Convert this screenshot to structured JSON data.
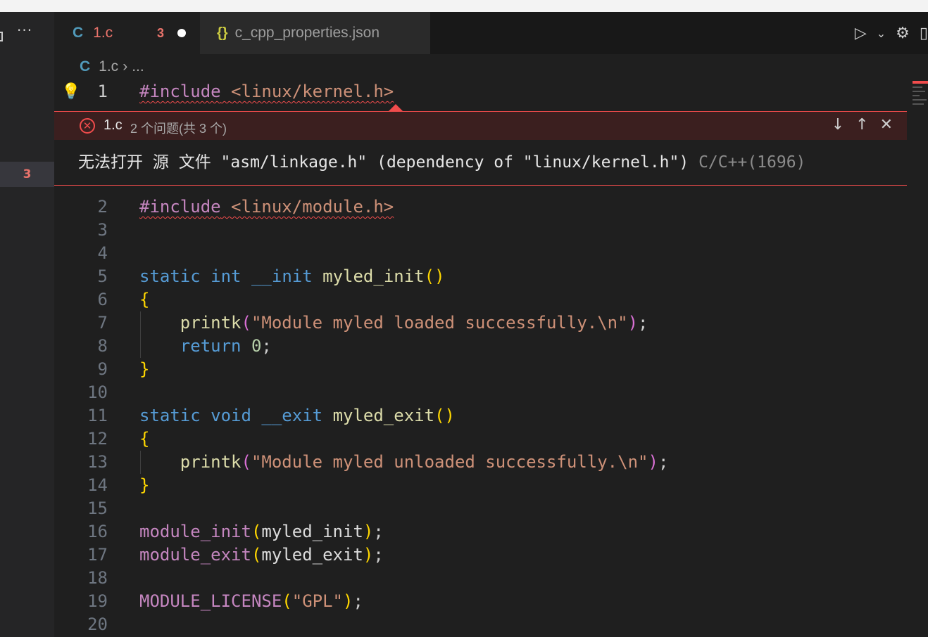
{
  "tabs": [
    {
      "icon": "C",
      "label": "1.c",
      "problems": "3",
      "modified": true,
      "active": true
    },
    {
      "icon": "{}",
      "label": "c_cpp_properties.json",
      "active": false
    }
  ],
  "sidebar": {
    "more": "···",
    "problems_badge": "3"
  },
  "breadcrumb": {
    "icon": "C",
    "file": "1.c",
    "sep": "›",
    "rest": "..."
  },
  "peek": {
    "file": "1.c",
    "count": "2 个问题(共 3 个)",
    "message": "无法打开 源 文件 \"asm/linkage.h\" (dependency of \"linux/kernel.h\")",
    "code": "C/C++(1696)",
    "next": "↓",
    "prev": "↑",
    "close": "✕"
  },
  "lines": [
    {
      "n": "1"
    },
    {
      "n": "2"
    },
    {
      "n": "3"
    },
    {
      "n": "4"
    },
    {
      "n": "5"
    },
    {
      "n": "6"
    },
    {
      "n": "7"
    },
    {
      "n": "8"
    },
    {
      "n": "9"
    },
    {
      "n": "10"
    },
    {
      "n": "11"
    },
    {
      "n": "12"
    },
    {
      "n": "13"
    },
    {
      "n": "14"
    },
    {
      "n": "15"
    },
    {
      "n": "16"
    },
    {
      "n": "17"
    },
    {
      "n": "18"
    },
    {
      "n": "19"
    },
    {
      "n": "20"
    }
  ],
  "code": {
    "l1_pp": "#include",
    "l1_inc": "<linux/kernel.h>",
    "l2_pp": "#include",
    "l2_inc": "<linux/module.h>",
    "static": "static",
    "int": "int",
    "void": "void",
    "init_attr": "__init",
    "exit_attr": "__exit",
    "init_fn": "myled_init",
    "exit_fn": "myled_exit",
    "printk": "printk",
    "str_load": "\"Module myled loaded successfully.\\n\"",
    "str_unload": "\"Module myled unloaded successfully.\\n\"",
    "return": "return",
    "zero": "0",
    "module_init": "module_init",
    "module_exit": "module_exit",
    "license": "MODULE_LICENSE",
    "gpl": "\"GPL\""
  }
}
